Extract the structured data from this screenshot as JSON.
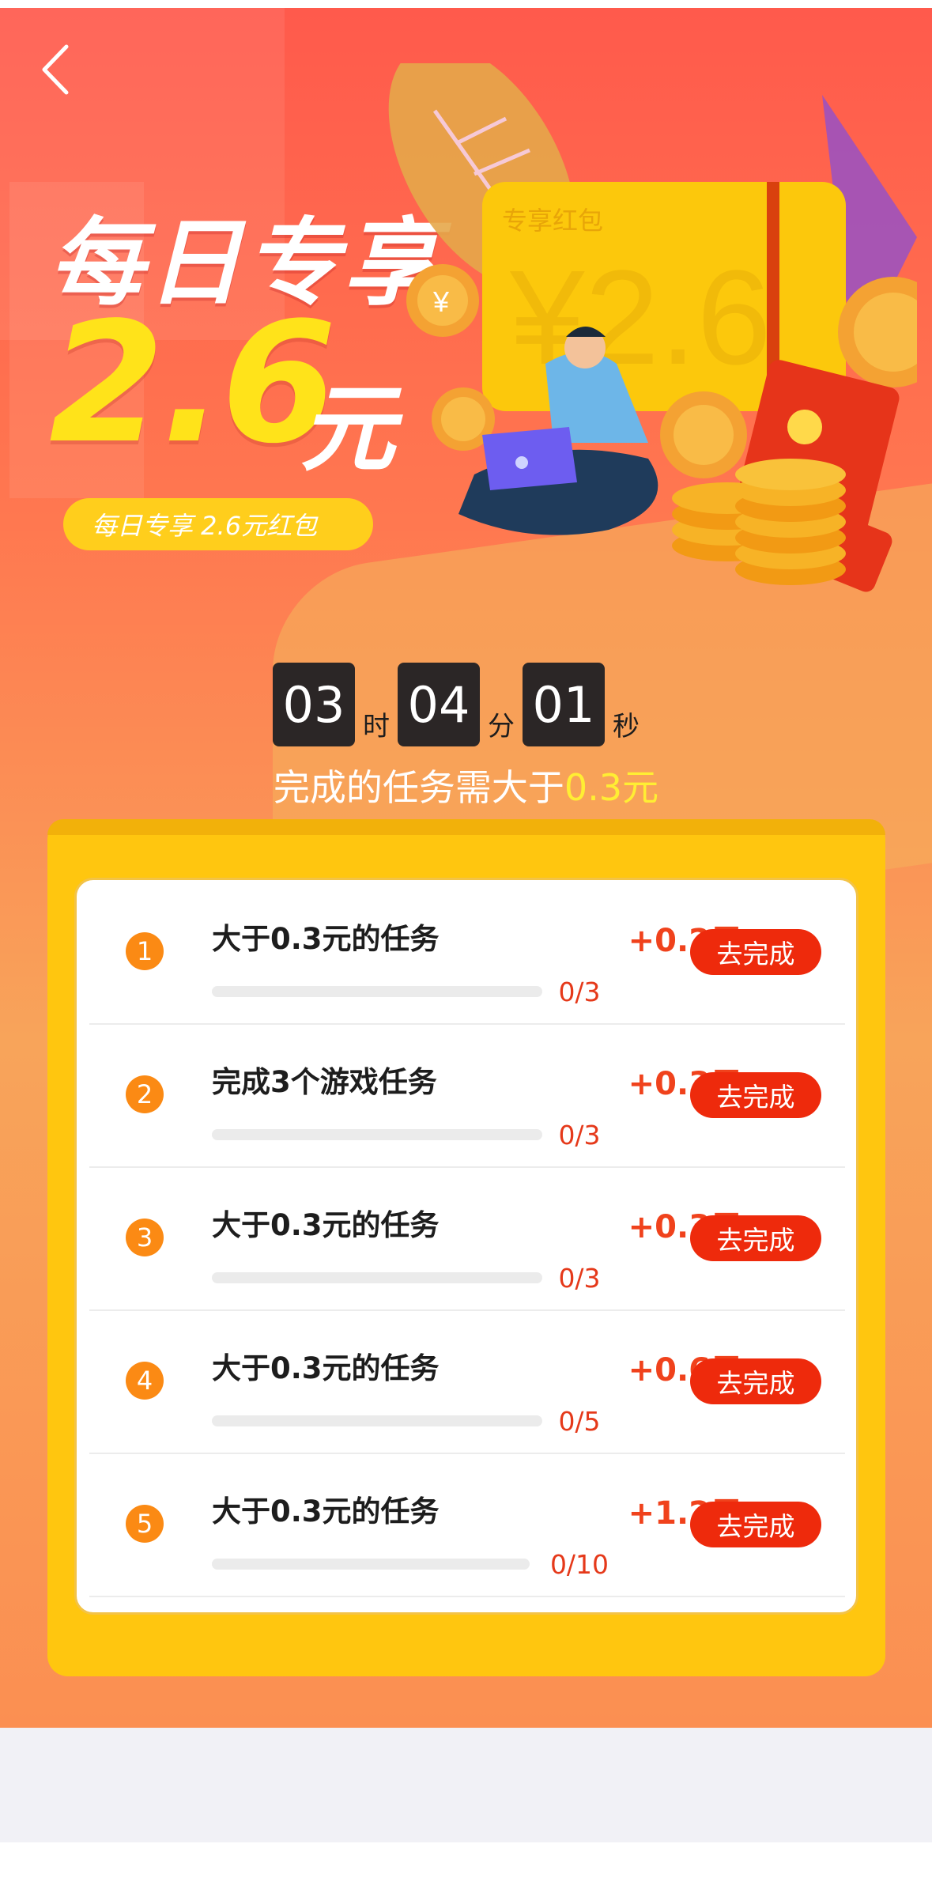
{
  "nav": {
    "back_icon": "chevron-left-icon"
  },
  "header": {
    "title": "每日专享",
    "amount_number": "2.6",
    "amount_unit": "元",
    "pill_text": "每日专享 2.6元红包"
  },
  "illustration": {
    "envelope_label": "专享红包",
    "envelope_amount": "¥2.6",
    "coin_symbol": "¥"
  },
  "countdown": {
    "hours": "03",
    "hours_unit": "时",
    "minutes": "04",
    "minutes_unit": "分",
    "seconds": "01",
    "seconds_unit": "秒"
  },
  "subtitle": {
    "prefix": "完成的任务需大于",
    "highlight": "0.3元"
  },
  "tasks": [
    {
      "num": "1",
      "title": "大于0.3元的任务",
      "reward": "+0.2元",
      "progress": "0/3",
      "progress_fraction": 0,
      "button": "去完成"
    },
    {
      "num": "2",
      "title": "完成3个游戏任务",
      "reward": "+0.3元",
      "progress": "0/3",
      "progress_fraction": 0,
      "button": "去完成"
    },
    {
      "num": "3",
      "title": "大于0.3元的任务",
      "reward": "+0.3元",
      "progress": "0/3",
      "progress_fraction": 0,
      "button": "去完成"
    },
    {
      "num": "4",
      "title": "大于0.3元的任务",
      "reward": "+0.6元",
      "progress": "0/5",
      "progress_fraction": 0,
      "button": "去完成"
    },
    {
      "num": "5",
      "title": "大于0.3元的任务",
      "reward": "+1.2元",
      "progress": "0/10",
      "progress_fraction": 0,
      "button": "去完成"
    }
  ],
  "colors": {
    "accent_red": "#ee2a0c",
    "gold": "#ffc60f",
    "highlight_yellow": "#ffee33",
    "number_orange": "#fb8a14"
  }
}
